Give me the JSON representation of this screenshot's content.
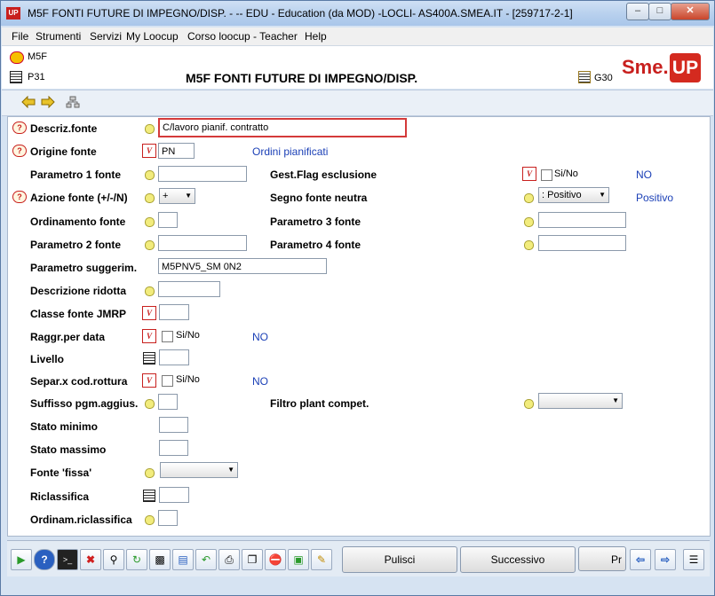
{
  "window": {
    "title": "M5F FONTI FUTURE DI IMPEGNO/DISP. -  -- EDU - Education (da MOD) -LOCLI- AS400A.SMEA.IT - [259717-2-1]",
    "app_icon_text": "UP"
  },
  "menu": [
    {
      "label": "File"
    },
    {
      "label": "Strumenti"
    },
    {
      "label": "Servizi"
    },
    {
      "label": "My Loocup"
    },
    {
      "label": "Corso loocup - Teacher"
    },
    {
      "label": "Help"
    }
  ],
  "header": {
    "code1": "M5F",
    "code2": "P31",
    "page_title": "M5F FONTI FUTURE DI IMPEGNO/DISP.",
    "g30": "G30",
    "logo_sme": "Sme.",
    "logo_up": "UP"
  },
  "form": {
    "descriz_fonte": {
      "label": "Descriz.fonte",
      "value": "C/lavoro pianif. contratto"
    },
    "origine_fonte": {
      "label": "Origine fonte",
      "value": "PN",
      "desc": "Ordini pianificati"
    },
    "parametro1": {
      "label": "Parametro 1 fonte",
      "value": ""
    },
    "gest_flag": {
      "label": "Gest.Flag esclusione",
      "check_label": "Si/No",
      "value_text": "NO"
    },
    "azione_fonte": {
      "label": "Azione fonte (+/-/N)",
      "value": "+"
    },
    "segno_fonte": {
      "label": "Segno fonte neutra",
      "value": ": Positivo",
      "value_text": "Positivo"
    },
    "ordinamento": {
      "label": "Ordinamento fonte",
      "value": ""
    },
    "parametro3": {
      "label": "Parametro 3 fonte",
      "value": ""
    },
    "parametro2": {
      "label": "Parametro 2 fonte",
      "value": ""
    },
    "parametro4": {
      "label": "Parametro 4 fonte",
      "value": ""
    },
    "parametro_sugg": {
      "label": "Parametro suggerim.",
      "value": "M5PNV5_SM 0N2"
    },
    "descrizione_ridotta": {
      "label": "Descrizione ridotta",
      "value": ""
    },
    "classe_fonte": {
      "label": "Classe fonte JMRP",
      "value": ""
    },
    "raggr_data": {
      "label": "Raggr.per data",
      "check_label": "Si/No",
      "value_text": "NO"
    },
    "livello": {
      "label": "Livello",
      "value": ""
    },
    "separ_cod": {
      "label": "Separ.x cod.rottura",
      "check_label": "Si/No",
      "value_text": "NO"
    },
    "suffisso": {
      "label": "Suffisso pgm.aggius.",
      "value": ""
    },
    "filtro_plant": {
      "label": "Filtro plant compet.",
      "value": ""
    },
    "stato_minimo": {
      "label": "Stato minimo",
      "value": ""
    },
    "stato_massimo": {
      "label": "Stato massimo",
      "value": ""
    },
    "fonte_fissa": {
      "label": "Fonte 'fissa'",
      "value": ""
    },
    "riclassifica": {
      "label": "Riclassifica",
      "value": ""
    },
    "ordinam_ricl": {
      "label": "Ordinam.riclassifica",
      "value": ""
    }
  },
  "bottom": {
    "pulisci": "Pulisci",
    "successivo": "Successivo",
    "pr": "Pr"
  }
}
